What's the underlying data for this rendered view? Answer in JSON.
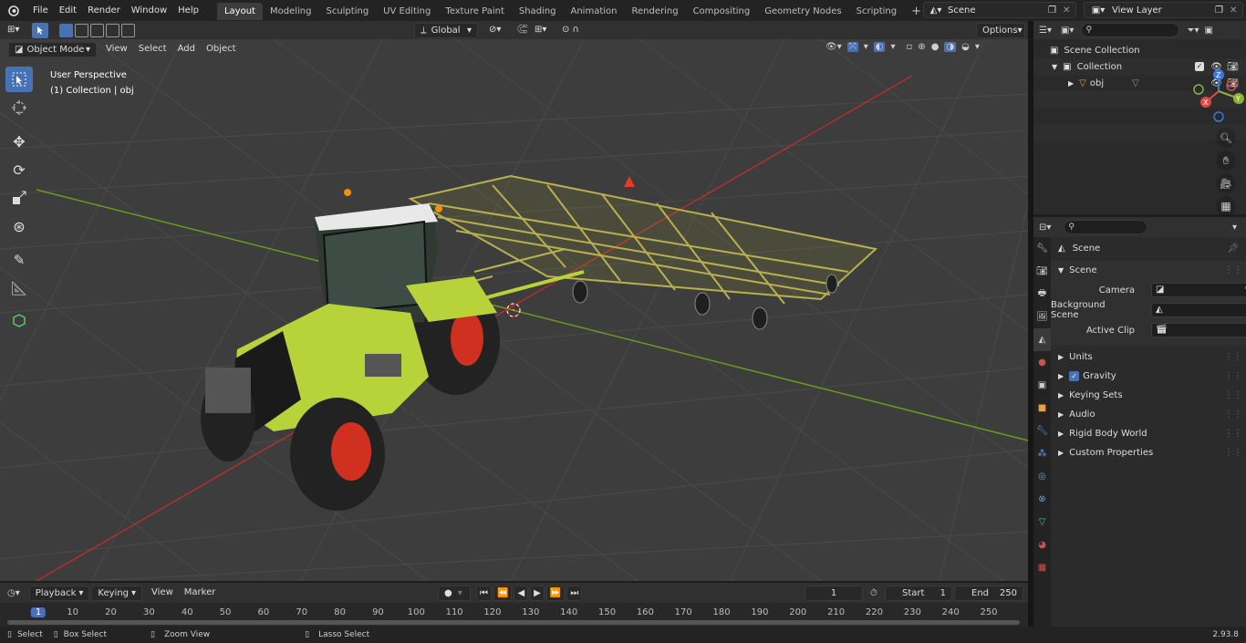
{
  "menu": {
    "file": "File",
    "edit": "Edit",
    "render": "Render",
    "window": "Window",
    "help": "Help"
  },
  "workspaces": [
    "Layout",
    "Modeling",
    "Sculpting",
    "UV Editing",
    "Texture Paint",
    "Shading",
    "Animation",
    "Rendering",
    "Compositing",
    "Geometry Nodes",
    "Scripting"
  ],
  "scene_name": "Scene",
  "view_layer": "View Layer",
  "viewport_header": {
    "orientation": "Global",
    "options": "Options"
  },
  "viewport_header2": {
    "mode": "Object Mode",
    "view": "View",
    "select": "Select",
    "add": "Add",
    "object": "Object"
  },
  "overlay": {
    "perspective": "User Perspective",
    "collection": "(1) Collection | obj"
  },
  "gizmo": {
    "z": "Z",
    "y": "Y",
    "x": "X"
  },
  "outliner": {
    "scene_collection": "Scene Collection",
    "collection": "Collection",
    "obj": "obj"
  },
  "properties": {
    "header": "Scene",
    "section": "Scene",
    "camera": "Camera",
    "background_scene": "Background Scene",
    "active_clip": "Active Clip",
    "panels": [
      "Units",
      "Gravity",
      "Keying Sets",
      "Audio",
      "Rigid Body World",
      "Custom Properties"
    ]
  },
  "timeline_header": {
    "playback": "Playback",
    "keying": "Keying",
    "view": "View",
    "marker": "Marker",
    "current_frame": "1",
    "start_label": "Start",
    "start": "1",
    "end_label": "End",
    "end": "250"
  },
  "timeline_ticks": [
    "1",
    "10",
    "20",
    "30",
    "40",
    "50",
    "60",
    "70",
    "80",
    "90",
    "100",
    "110",
    "120",
    "130",
    "140",
    "150",
    "160",
    "170",
    "180",
    "190",
    "200",
    "210",
    "220",
    "230",
    "240",
    "250"
  ],
  "statusbar": {
    "select": "Select",
    "box_select": "Box Select",
    "zoom_view": "Zoom View",
    "lasso_select": "Lasso Select",
    "version": "2.93.8"
  },
  "colors": {
    "accent": "#4772b3",
    "tractor_green": "#b8d23a",
    "wheel_red": "#d03020",
    "axis_x": "#b03030",
    "axis_y": "#6a9a20"
  }
}
